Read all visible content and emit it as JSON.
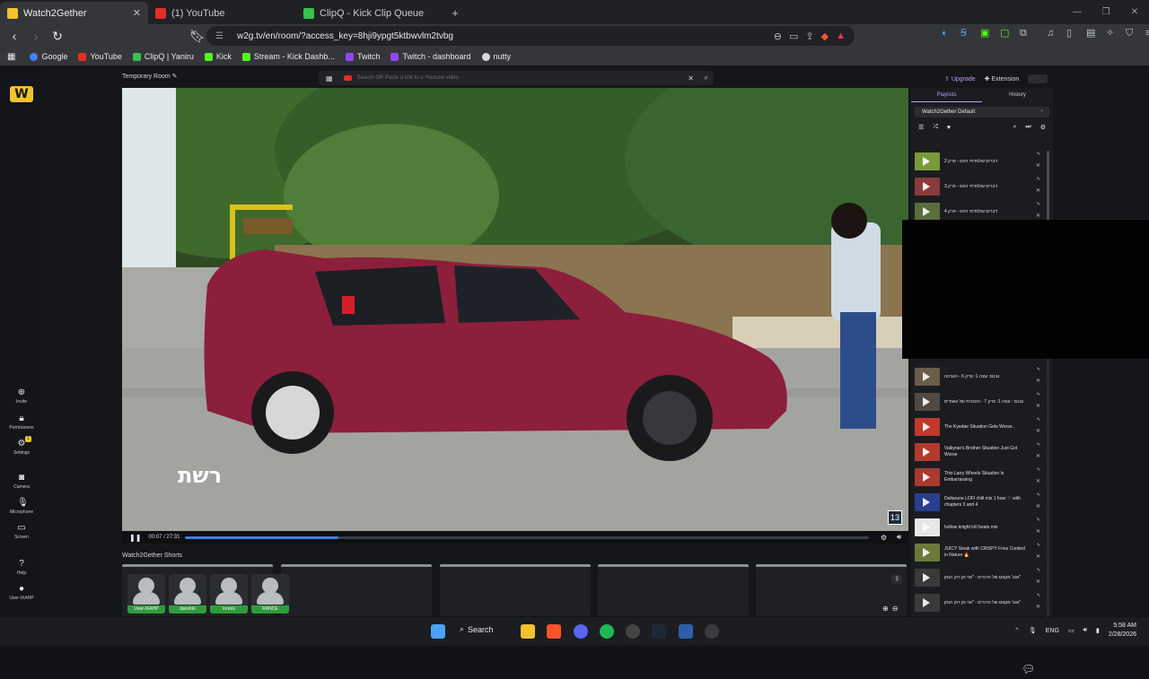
{
  "browser": {
    "tabs": [
      {
        "title": "Watch2Gether",
        "active": true,
        "favicon_color": "#f2c230"
      },
      {
        "title": "(1) YouTube",
        "active": false,
        "favicon_color": "#e52d27"
      },
      {
        "title": "ClipQ - Kick Clip Queue",
        "active": false,
        "favicon_color": "#35c44d"
      }
    ],
    "url": "w2g.tv/en/room/?access_key=8hji9ypgt5ktbwvlm2tvbg",
    "bookmarks": [
      {
        "label": "Google",
        "color": "#4285f4"
      },
      {
        "label": "YouTube",
        "color": "#e52d27"
      },
      {
        "label": "ClipQ | Yaniru",
        "color": "#35c44d"
      },
      {
        "label": "Kick",
        "color": "#53fc18"
      },
      {
        "label": "Stream - Kick Dashb...",
        "color": "#53fc18"
      },
      {
        "label": "Twitch",
        "color": "#9146ff"
      },
      {
        "label": "Twitch - dashboard",
        "color": "#9146ff"
      },
      {
        "label": "nutty",
        "color": "#d6d8dc"
      }
    ]
  },
  "room": {
    "title": "Temporary Room",
    "search_placeholder": "Search OR Paste a link to a Youtube video",
    "upgrade_label": "Upgrade",
    "extension_label": "Extension"
  },
  "sidebar": {
    "items": [
      {
        "label": "Invite",
        "icon": "invite-icon"
      },
      {
        "label": "Permissions",
        "icon": "lock-icon"
      },
      {
        "label": "Settings",
        "icon": "gear-icon",
        "badge": "1"
      },
      {
        "label": "Camera",
        "icon": "camera-icon"
      },
      {
        "label": "Microphone",
        "icon": "microphone-icon"
      },
      {
        "label": "Screen",
        "icon": "screen-icon"
      },
      {
        "label": "Help",
        "icon": "help-icon"
      },
      {
        "label": "User-IXAHP",
        "icon": "user-icon"
      }
    ]
  },
  "player": {
    "time": "00:07 / 27:31",
    "progress": 0.224,
    "watermark": "רשת",
    "channel_badge": "13"
  },
  "shorts": {
    "title": "Watch2Gether Shorts",
    "count": "3"
  },
  "users": [
    {
      "name": "User-IXAHP"
    },
    {
      "name": "danshin"
    },
    {
      "name": "lorens"
    },
    {
      "name": "RANCE"
    }
  ],
  "playlist": {
    "tabs": [
      "Playlists",
      "History"
    ],
    "selected": "Watch2Gether Default",
    "items": [
      {
        "title": "דברים שלמדתי היום - פרק 2",
        "color": "#7a9a3a"
      },
      {
        "title": "דברים שלמדתי היום - פרק 3",
        "color": "#8a3b3b"
      },
      {
        "title": "דברים שלמדתי היום - פרק 4",
        "color": "#5b6d3c"
      },
      {
        "title": "גבנם: עונה 1: פרק 6 - הגבהה",
        "color": "#6b5b4a"
      },
      {
        "title": "גבנם : עונה 1: פרק 7 - הטכנית של עשורים",
        "color": "#4f4a44"
      },
      {
        "title": "The Kyedae Situation Gets Worse..",
        "color": "#c0392b"
      },
      {
        "title": "Valkyrae's Brother Situation Just Got Worse",
        "color": "#b33a2f"
      },
      {
        "title": "This Larry Wheels Situation Is Embarrassing",
        "color": "#a83a2f"
      },
      {
        "title": "Deltarune LOFI chill mix 1 hour ♡ with chapters 3 and 4",
        "color": "#2a3f8f"
      },
      {
        "title": "hollow knight lofi beats mix",
        "color": "#e7e7e7"
      },
      {
        "title": "JUICY Steak with CRISPY Fries Cooked in Nature 🔥",
        "color": "#6b7a3a"
      },
      {
        "title": "אנג' מקאם של הדורים - \"אזי מן רוק הומן\"",
        "color": "#3a3a3a"
      },
      {
        "title": "אנג' מקאם של הדורים - \"אזי מן רוק הומן\"",
        "color": "#3a3a3a"
      }
    ]
  },
  "taskbar": {
    "search_label": "Search",
    "language": "ENG",
    "time": "5:58 AM",
    "date": "2/28/2026"
  }
}
